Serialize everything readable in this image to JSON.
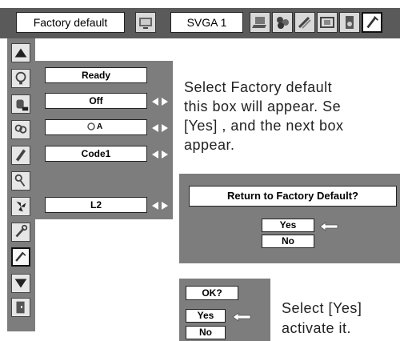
{
  "top_bar": {
    "menu_label": "Factory default",
    "input_label": "SVGA 1",
    "icons": [
      "screen-icon",
      "computer-icon",
      "image-adjust-icon",
      "image-select-icon",
      "screen-size-icon",
      "sound-icon",
      "setting-icon"
    ]
  },
  "left_menu": {
    "icons": [
      "arrow-up-icon",
      "lamp-icon",
      "hand-icon",
      "lamp-double-icon",
      "pencil-icon",
      "key-icon",
      "fan-icon",
      "wrench-icon",
      "factory-default-icon",
      "arrow-down-icon",
      "exit-door-icon"
    ],
    "selected": "factory-default-icon"
  },
  "settings": {
    "ready": "Ready",
    "off": "Off",
    "lamp_mode": "A",
    "code": "Code1",
    "l2": "L2"
  },
  "instruction1": {
    "line1": "Select Factory default",
    "line2": "this box will appear.  Se",
    "line3": "[Yes] , and the next box",
    "line4": "appear."
  },
  "dialog1": {
    "title": "Return to Factory Default?",
    "yes": "Yes",
    "no": "No"
  },
  "dialog2": {
    "title": "OK?",
    "yes": "Yes",
    "no": "No"
  },
  "instruction2": {
    "line1": "Select [Yes]",
    "line2": "activate it."
  }
}
